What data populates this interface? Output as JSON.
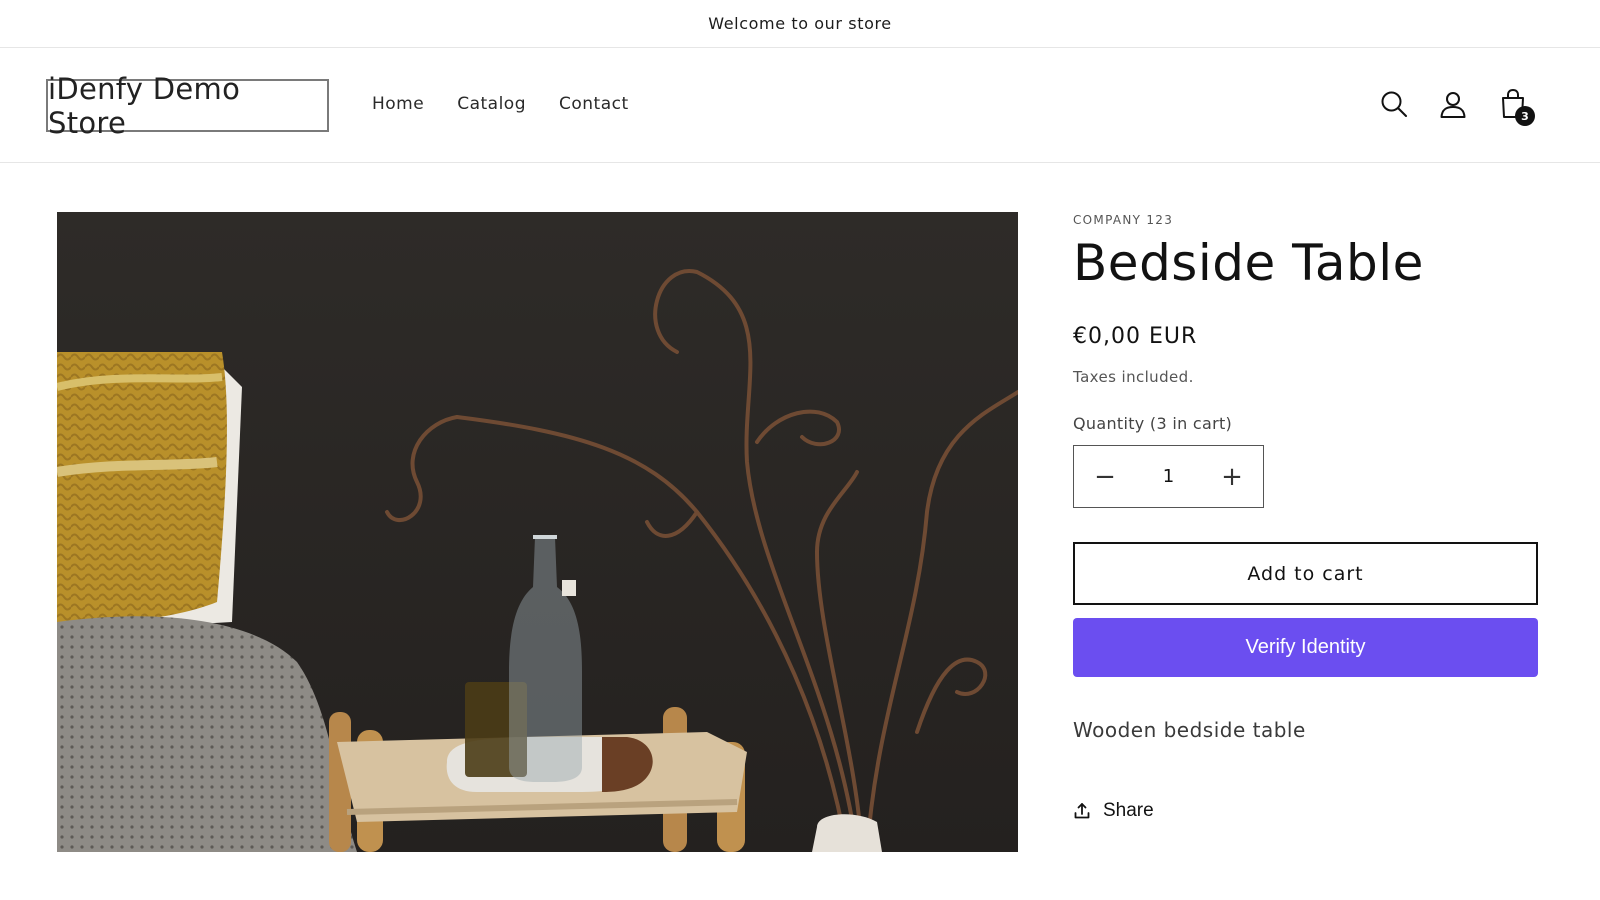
{
  "announcement": {
    "text": "Welcome to our store"
  },
  "header": {
    "logo_text": "iDenfy Demo Store",
    "nav": [
      {
        "label": "Home"
      },
      {
        "label": "Catalog"
      },
      {
        "label": "Contact"
      }
    ],
    "icons": {
      "search": "search-icon",
      "account": "account-icon",
      "cart": "cart-icon"
    },
    "cart_count": "3"
  },
  "product": {
    "image_icon": "bedside-table-photo",
    "vendor": "COMPANY 123",
    "title": "Bedside Table",
    "price": "€0,00 EUR",
    "tax_note": "Taxes included.",
    "quantity_label": "Quantity (3 in cart)",
    "quantity": {
      "minus": "−",
      "value": "1",
      "plus": "+"
    },
    "add_to_cart_label": "Add to cart",
    "verify_label": "Verify Identity",
    "description": "Wooden bedside table",
    "share_label": "Share"
  },
  "colors": {
    "accent_verify": "#6b4ef0",
    "text_primary": "#121212",
    "border": "#e6e6e6"
  }
}
